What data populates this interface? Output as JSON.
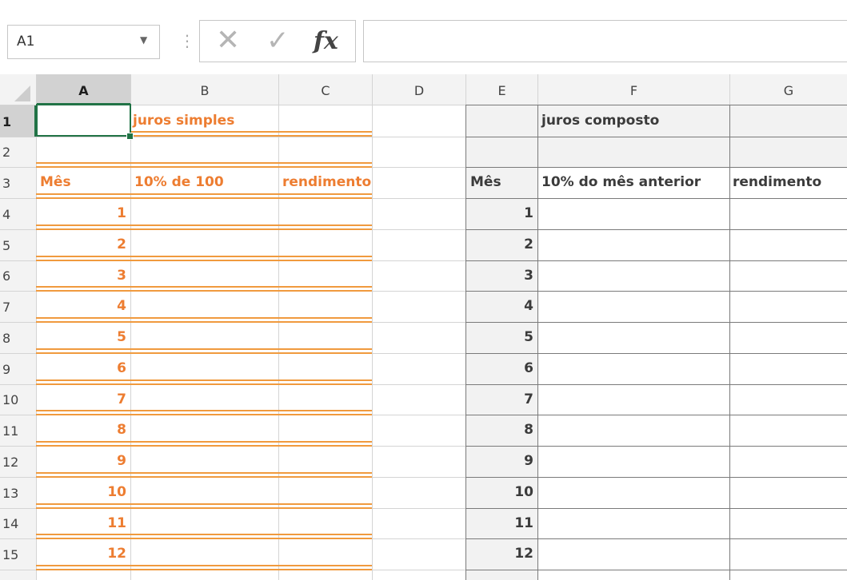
{
  "name_box": {
    "value": "A1"
  },
  "formula_bar": {
    "fx_label": "fx",
    "value": ""
  },
  "columns": [
    "A",
    "B",
    "C",
    "D",
    "E",
    "F",
    "G"
  ],
  "rows": [
    "1",
    "2",
    "3",
    "4",
    "5",
    "6",
    "7",
    "8",
    "9",
    "10",
    "11",
    "12",
    "13",
    "14",
    "15"
  ],
  "simple": {
    "title": "juros simples",
    "h_mes": "Mês",
    "h_pct": "10% de 100",
    "h_rend": "rendimento"
  },
  "compound": {
    "title": "juros composto",
    "h_mes": "Mês",
    "h_pct": "10% do mês anterior",
    "h_rend": "rendimento"
  },
  "months": [
    "1",
    "2",
    "3",
    "4",
    "5",
    "6",
    "7",
    "8",
    "9",
    "10",
    "11",
    "12"
  ],
  "colors": {
    "orange": "#ed7d31",
    "selection": "#217346",
    "gray_fill": "#f2f2f2"
  }
}
